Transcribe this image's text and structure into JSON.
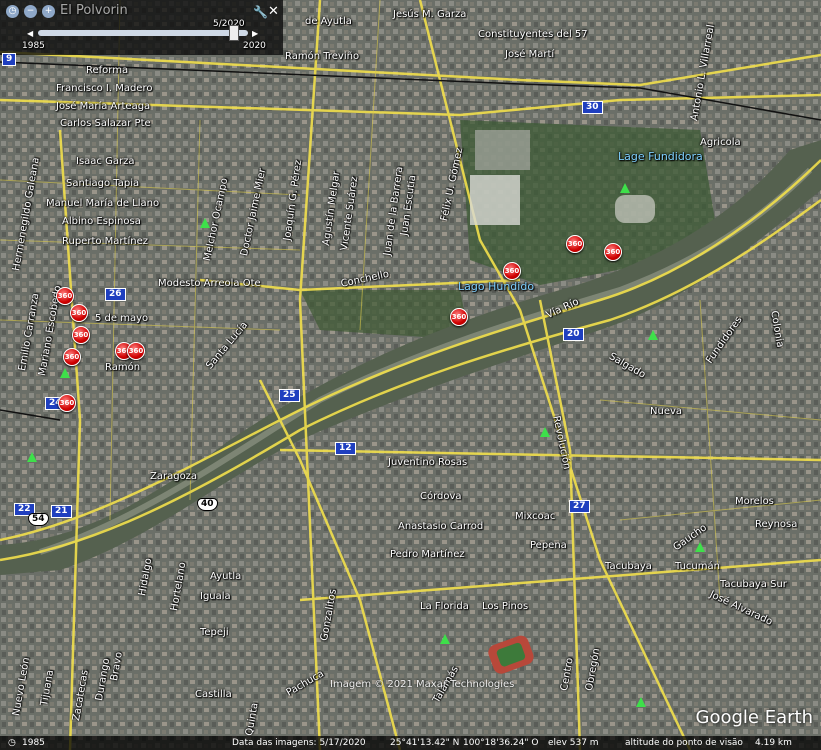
{
  "timeslider": {
    "start_year": "1985",
    "end_year": "2020",
    "current_date": "5/2020",
    "position": 0.93,
    "label_partial": "El Polvorin"
  },
  "streets": [
    "Jesús M. Garza",
    "Constituyentes del 57",
    "José Martí",
    "Ramón Treviño",
    "de Ayutla",
    "Reforma",
    "Francisco I. Madero",
    "José María Arteaga",
    "Carlos Salazar Pte",
    "Isaac Garza",
    "Santiago Tapia",
    "Manuel María de Llano",
    "Albino Espinosa",
    "Ruperto Martínez",
    "Modesto Arreola Ote",
    "5 de mayo",
    "Ramón",
    "Zaragoza",
    "Hermenegildo Galeana",
    "Emilio Carranza",
    "Mariano Escobedo",
    "Melchor Ocampo",
    "Doctor Jaime Mier",
    "Agustín Melgar",
    "Vicente Suárez",
    "Juan de la Barrera",
    "Juan Escutia",
    "Joaquín G. Pérez",
    "Félix U. Gómez",
    "Conchello",
    "Santa Lucía",
    "Vía Río",
    "Salgado",
    "Nueva",
    "Juventino Rosas",
    "Córdova",
    "Anastasio Carrod",
    "Pedro Martínez",
    "Pepena",
    "Mixcoac",
    "Tacubaya",
    "Tucumán",
    "Los Pinos",
    "La Florida",
    "Ayutla",
    "Iguala",
    "Tepeji",
    "Pachuca",
    "José Alvarado",
    "Agricola",
    "Morelos",
    "Reynosa",
    "Fundidores",
    "Revolución",
    "Gaucho",
    "Colonia",
    "Antonio L. Villarreal",
    "Tacubaya Sur",
    "Quinta",
    "Centro",
    "Obregón",
    "Gonzalitos",
    "Castilla",
    "Durango",
    "Zacatecas",
    "Nuevo León",
    "Bravo",
    "Tijuana",
    "Hortelano",
    "Hidalgo",
    "Talamás"
  ],
  "pois": {
    "parque_fundidora": "Lage Fundidora",
    "lago_hundido": "Lago Hundido"
  },
  "route_shields": [
    "30",
    "26",
    "20",
    "25",
    "12",
    "27",
    "22",
    "21",
    "24",
    "9"
  ],
  "highway_shields": [
    "40",
    "54"
  ],
  "badge_label": "360",
  "status": {
    "year": "1985",
    "image_date": "Data das imagens: 5/17/2020",
    "lat": "25°41'13.42\" N",
    "lon": "100°18'36.24\" O",
    "elev": "elev 537 m",
    "eye_alt": "altitude do ponto de visão",
    "eye_val": "4.19 km"
  },
  "attribution": "Imagem © 2021 Maxar Technologies",
  "brand": "Google Earth",
  "colors": {
    "road": "#f2e04c",
    "river": "#4c5c4a",
    "shield": "#1f3fbf",
    "badge": "#d00000"
  }
}
